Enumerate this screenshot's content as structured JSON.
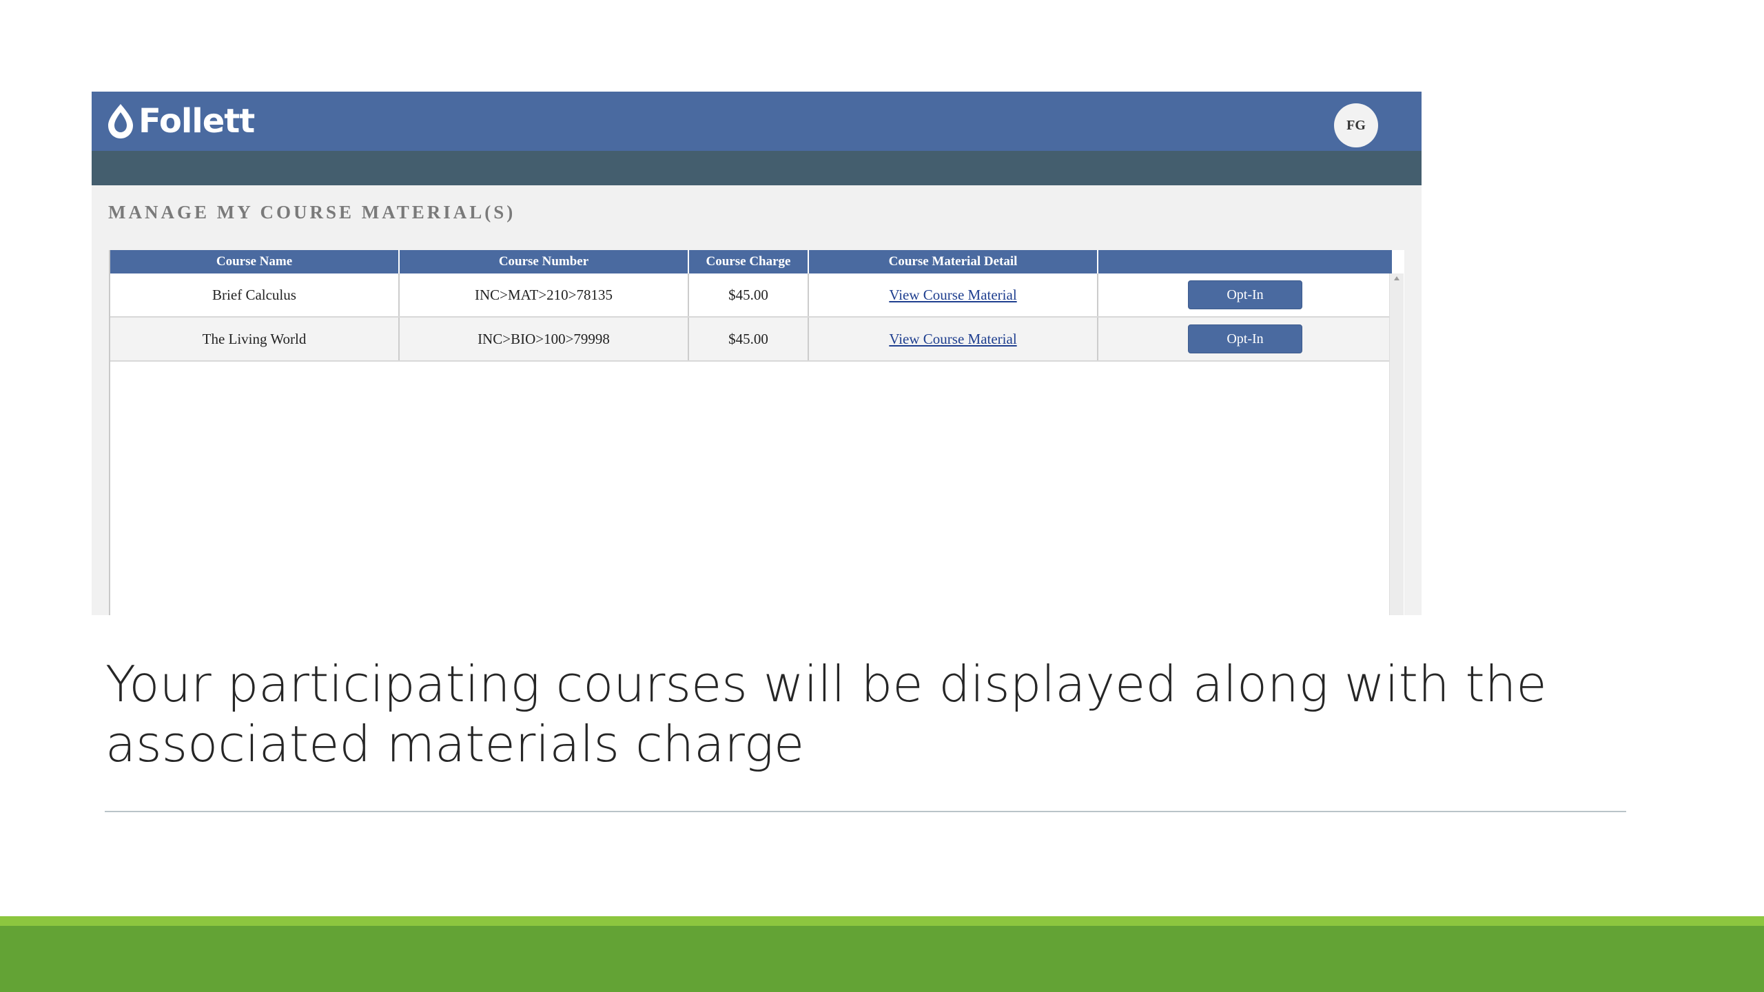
{
  "app": {
    "logo_text": "Follett",
    "avatar_initials": "FG",
    "page_heading": "MANAGE MY COURSE MATERIAL(S)"
  },
  "table": {
    "headers": [
      "Course Name",
      "Course Number",
      "Course Charge",
      "Course Material Detail",
      ""
    ],
    "rows": [
      {
        "course_name": "Brief Calculus",
        "course_number": "INC>MAT>210>78135",
        "course_charge": "$45.00",
        "detail_link": "View Course Material",
        "action_label": "Opt-In"
      },
      {
        "course_name": "The Living World",
        "course_number": "INC>BIO>100>79998",
        "course_charge": "$45.00",
        "detail_link": "View Course Material",
        "action_label": "Opt-In"
      }
    ]
  },
  "slide": {
    "caption": "Your participating courses will be displayed along with the associated materials charge"
  },
  "colors": {
    "header_blue": "#4a6aa0",
    "subbar_slate": "#445e6e",
    "footer_green": "#63a335",
    "footer_lime": "#8cc63f"
  }
}
